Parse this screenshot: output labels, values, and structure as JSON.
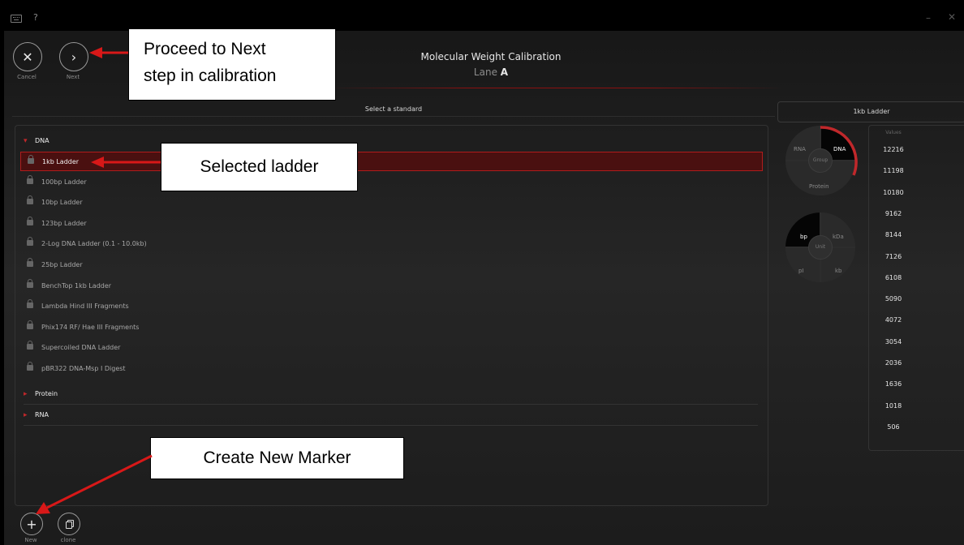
{
  "titlebar": {
    "help": "?",
    "minimize": "–",
    "close": "✕"
  },
  "toolbar": {
    "cancel": {
      "glyph": "✕",
      "label": "Cancel"
    },
    "next": {
      "glyph": "›",
      "label": "Next"
    }
  },
  "header": {
    "title": "Molecular Weight Calibration",
    "lane_label": "Lane",
    "lane_value": "A"
  },
  "standard_header": "Select a standard",
  "selected_ladder_header": "1kb Ladder",
  "groups": [
    {
      "name": "DNA",
      "expanded": true,
      "items": [
        "1kb Ladder",
        "100bp Ladder",
        "10bp Ladder",
        "123bp Ladder",
        "2-Log DNA Ladder (0.1 - 10.0kb)",
        "25bp Ladder",
        "BenchTop 1kb Ladder",
        "Lambda Hind III Fragments",
        "Phix174 RF/ Hae III Fragments",
        "Supercoiled DNA Ladder",
        "pBR322 DNA-Msp I Digest"
      ],
      "selected_index": 0
    },
    {
      "name": "Protein",
      "expanded": false,
      "items": []
    },
    {
      "name": "RNA",
      "expanded": false,
      "items": []
    }
  ],
  "group_wheel": {
    "center": "Group",
    "options": [
      "RNA",
      "DNA",
      "Protein"
    ],
    "selected": "DNA"
  },
  "unit_wheel": {
    "center": "Unit",
    "options": [
      "bp",
      "kDa",
      "pI",
      "kb"
    ],
    "selected": "bp"
  },
  "values": {
    "header": "Values",
    "items": [
      "12216",
      "11198",
      "10180",
      "9162",
      "8144",
      "7126",
      "6108",
      "5090",
      "4072",
      "3054",
      "2036",
      "1636",
      "1018",
      "506"
    ]
  },
  "bottom": {
    "new_label": "New",
    "clone_label": "clone"
  },
  "annotations": {
    "next_step_line1": "Proceed to Next",
    "next_step_line2": "step in calibration",
    "selected_ladder": "Selected ladder",
    "create_marker": "Create New Marker"
  },
  "colors": {
    "accent": "#c0282b",
    "selected_row_bg": "#4a1010",
    "annotation_arrow": "#d81818"
  },
  "icons": {
    "keyboard": "keyboard-icon",
    "lock": "lock-icon",
    "plus": "plus-icon",
    "clone": "clone-icon"
  }
}
